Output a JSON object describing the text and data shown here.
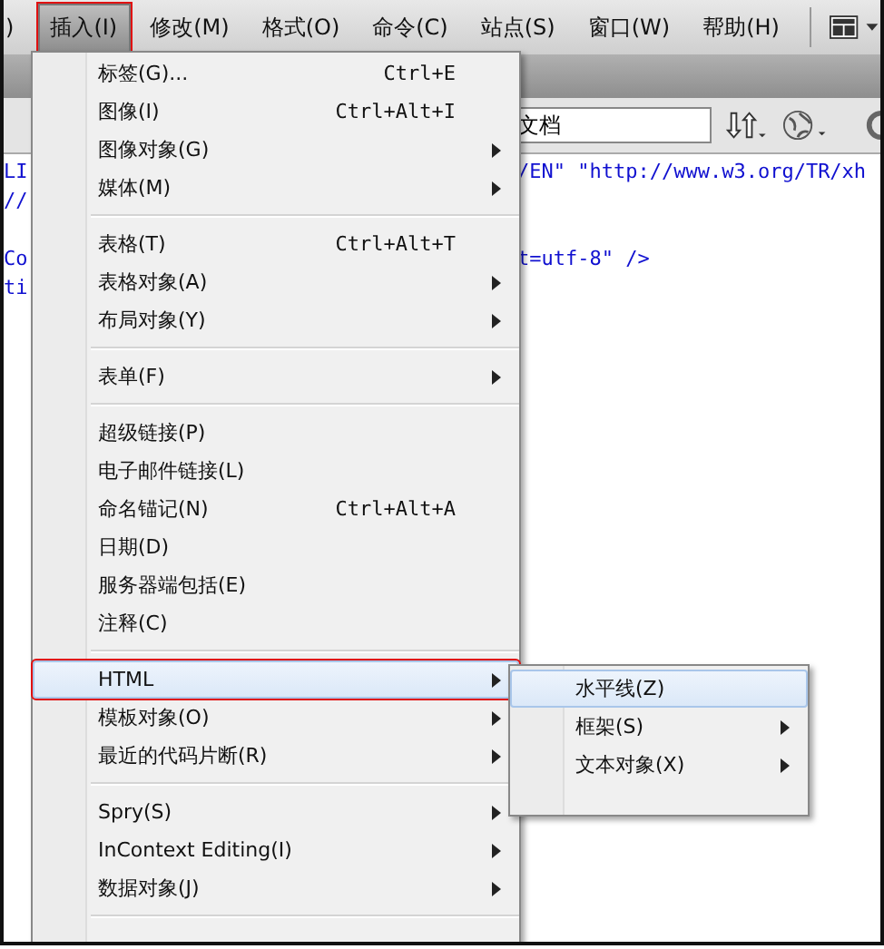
{
  "menubar": {
    "items": [
      {
        "label": ")",
        "selected": false,
        "highlighted": false
      },
      {
        "label": "插入(I)",
        "selected": true,
        "highlighted": true
      },
      {
        "label": "修改(M)",
        "selected": false,
        "highlighted": false
      },
      {
        "label": "格式(O)",
        "selected": false,
        "highlighted": false
      },
      {
        "label": "命令(C)",
        "selected": false,
        "highlighted": false
      },
      {
        "label": "站点(S)",
        "selected": false,
        "highlighted": false
      },
      {
        "label": "窗口(W)",
        "selected": false,
        "highlighted": false
      },
      {
        "label": "帮助(H)",
        "selected": false,
        "highlighted": false
      }
    ]
  },
  "toolbar": {
    "field_value": "文档"
  },
  "code_lines": [
    {
      "kind": "code",
      "left": "LI",
      "right": "/EN\" \"http://www.w3.org/TR/xh"
    },
    {
      "kind": "code",
      "left": "//"
    },
    {
      "kind": "blank"
    },
    {
      "kind": "code",
      "left": "Co",
      "right": "t=utf-8\" />"
    },
    {
      "kind": "code",
      "left": "ti"
    }
  ],
  "menu": {
    "items": [
      {
        "kind": "item",
        "label": "标签(G)...",
        "shortcut": "Ctrl+E",
        "submenu": false,
        "selected": false,
        "highlighted": false
      },
      {
        "kind": "item",
        "label": "图像(I)",
        "shortcut": "Ctrl+Alt+I",
        "submenu": false,
        "selected": false,
        "highlighted": false
      },
      {
        "kind": "item",
        "label": "图像对象(G)",
        "submenu": true,
        "selected": false,
        "highlighted": false
      },
      {
        "kind": "item",
        "label": "媒体(M)",
        "submenu": true,
        "selected": false,
        "highlighted": false
      },
      {
        "kind": "separator"
      },
      {
        "kind": "item",
        "label": "表格(T)",
        "shortcut": "Ctrl+Alt+T",
        "submenu": false,
        "selected": false,
        "highlighted": false
      },
      {
        "kind": "item",
        "label": "表格对象(A)",
        "submenu": true,
        "selected": false,
        "highlighted": false
      },
      {
        "kind": "item",
        "label": "布局对象(Y)",
        "submenu": true,
        "selected": false,
        "highlighted": false
      },
      {
        "kind": "separator"
      },
      {
        "kind": "item",
        "label": "表单(F)",
        "submenu": true,
        "selected": false,
        "highlighted": false
      },
      {
        "kind": "separator"
      },
      {
        "kind": "item",
        "label": "超级链接(P)",
        "submenu": false,
        "selected": false,
        "highlighted": false
      },
      {
        "kind": "item",
        "label": "电子邮件链接(L)",
        "submenu": false,
        "selected": false,
        "highlighted": false
      },
      {
        "kind": "item",
        "label": "命名锚记(N)",
        "shortcut": "Ctrl+Alt+A",
        "submenu": false,
        "selected": false,
        "highlighted": false
      },
      {
        "kind": "item",
        "label": "日期(D)",
        "submenu": false,
        "selected": false,
        "highlighted": false
      },
      {
        "kind": "item",
        "label": "服务器端包括(E)",
        "submenu": false,
        "selected": false,
        "highlighted": false
      },
      {
        "kind": "item",
        "label": "注释(C)",
        "submenu": false,
        "selected": false,
        "highlighted": false
      },
      {
        "kind": "separator"
      },
      {
        "kind": "item",
        "label": "HTML",
        "submenu": true,
        "selected": true,
        "highlighted": true
      },
      {
        "kind": "item",
        "label": "模板对象(O)",
        "submenu": true,
        "selected": false,
        "highlighted": false
      },
      {
        "kind": "item",
        "label": "最近的代码片断(R)",
        "submenu": true,
        "selected": false,
        "highlighted": false
      },
      {
        "kind": "separator"
      },
      {
        "kind": "item",
        "label": "Spry(S)",
        "submenu": true,
        "selected": false,
        "highlighted": false
      },
      {
        "kind": "item",
        "label": "InContext Editing(I)",
        "submenu": true,
        "selected": false,
        "highlighted": false
      },
      {
        "kind": "item",
        "label": "数据对象(J)",
        "submenu": true,
        "selected": false,
        "highlighted": false
      },
      {
        "kind": "separator"
      }
    ]
  },
  "submenu": {
    "items": [
      {
        "kind": "item",
        "label": "水平线(Z)",
        "submenu": false,
        "selected": true,
        "highlighted": false
      },
      {
        "kind": "item",
        "label": "框架(S)",
        "submenu": true,
        "selected": false,
        "highlighted": false
      },
      {
        "kind": "item",
        "label": "文本对象(X)",
        "submenu": true,
        "selected": false,
        "highlighted": false
      }
    ]
  }
}
